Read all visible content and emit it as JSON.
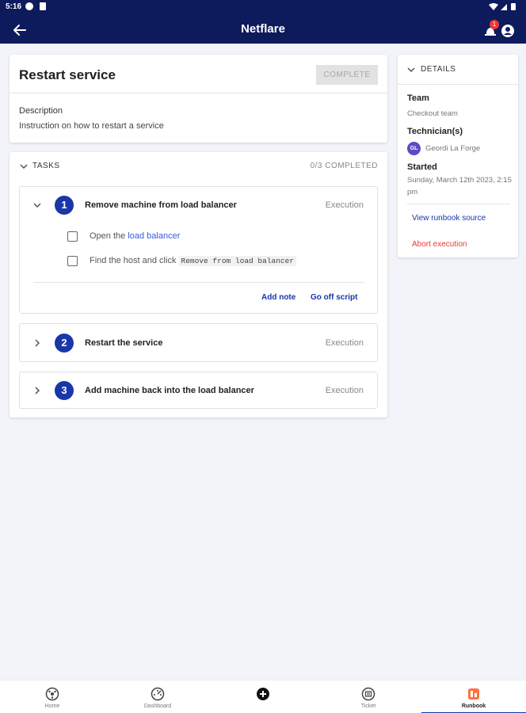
{
  "status_bar": {
    "time": "5:16"
  },
  "app_bar": {
    "title": "Netflare",
    "notification_count": "1"
  },
  "header": {
    "title": "Restart service",
    "complete_label": "COMPLETE",
    "description_label": "Description",
    "description_text": "Instruction on how to restart a service"
  },
  "tasks": {
    "label": "TASKS",
    "count": "0/3 COMPLETED",
    "items": [
      {
        "number": "1",
        "title": "Remove machine from load balancer",
        "status": "Execution",
        "steps": [
          {
            "prefix": "Open the ",
            "link": "load balancer"
          },
          {
            "prefix": "Find the host and click ",
            "code": "Remove from load balancer"
          }
        ],
        "add_note": "Add note",
        "go_off_script": "Go off script"
      },
      {
        "number": "2",
        "title": "Restart the service",
        "status": "Execution"
      },
      {
        "number": "3",
        "title": "Add machine back into the load balancer",
        "status": "Execution"
      }
    ]
  },
  "details": {
    "label": "DETAILS",
    "team_label": "Team",
    "team_value": "Checkout team",
    "technicians_label": "Technician(s)",
    "technician_initials": "GL",
    "technician_name": "Geordi La Forge",
    "started_label": "Started",
    "started_value": "Sunday, March 12th 2023, 2:15 pm",
    "view_source": "View runbook source",
    "abort": "Abort execution"
  },
  "bottom_nav": {
    "items": [
      {
        "label": "Home",
        "icon": "home-icon"
      },
      {
        "label": "Dashboard",
        "icon": "dashboard-icon"
      },
      {
        "label": "",
        "icon": "add-icon"
      },
      {
        "label": "Ticket",
        "icon": "ticket-icon"
      },
      {
        "label": "Runbook",
        "icon": "runbook-icon"
      }
    ],
    "active": "Runbook"
  },
  "colors": {
    "primary": "#0d1a5c",
    "accent": "#1a36a8",
    "link": "#3a5bd9",
    "danger": "#e53935",
    "background": "#f3f4fa"
  }
}
